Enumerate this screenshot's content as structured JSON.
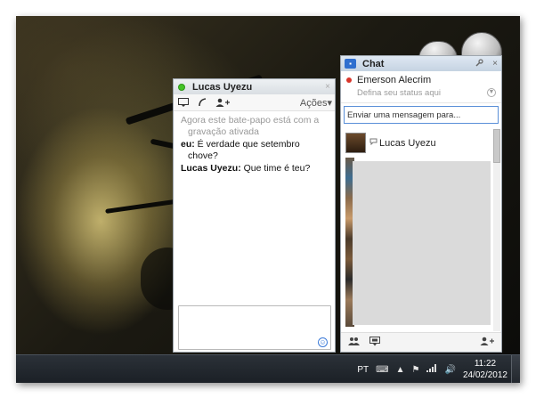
{
  "conversation": {
    "contact_name": "Lucas Uyezu",
    "close_glyph": "×",
    "actions_label": "Ações",
    "actions_arrow": "▾",
    "system_line1": "Agora este bate-papo está com a",
    "system_line2": "gravação ativada",
    "messages": [
      {
        "sender": "eu:",
        "line1": "É verdade que setembro",
        "line2": "chove?"
      },
      {
        "sender": "Lucas Uyezu:",
        "line1": "Que time é teu?",
        "line2": ""
      }
    ],
    "toolbar_icons": [
      "video-icon",
      "phone-icon",
      "add-person-icon"
    ]
  },
  "chat": {
    "title": "Chat",
    "me_name": "Emerson Alecrim",
    "me_status_placeholder": "Defina seu status aqui",
    "search_placeholder": "Enviar uma mensagem para...",
    "buddy_name": "Lucas Uyezu",
    "close_glyph": "×",
    "settings_glyph": "🔧"
  },
  "taskbar": {
    "language": "PT",
    "time": "11:22",
    "date": "24/02/2012"
  },
  "colors": {
    "online": "#44c427",
    "busy": "#d9362b",
    "accent": "#2f6fcf"
  }
}
